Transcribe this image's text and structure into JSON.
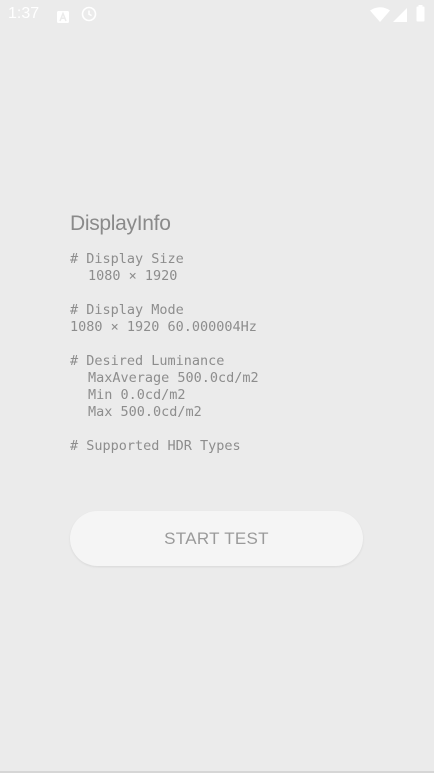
{
  "status_bar": {
    "time": "1:37",
    "icons": [
      "a-notification-icon",
      "clock-icon",
      "wifi-icon",
      "signal-icon",
      "battery-icon"
    ]
  },
  "display_info": {
    "title": "DisplayInfo",
    "display_size_header": "# Display Size",
    "display_size_value": "1080 × 1920",
    "display_mode_header": "# Display Mode",
    "display_mode_value": "1080 × 1920 60.000004Hz",
    "luminance_header": "# Desired Luminance",
    "max_average": "MaxAverage 500.0cd/m2",
    "min": "Min 0.0cd/m2",
    "max": "Max 500.0cd/m2",
    "hdr_header": "# Supported HDR Types"
  },
  "actions": {
    "start_test_label": "START TEST"
  },
  "colors": {
    "background": "#ebebeb",
    "text": "#8d8d8d",
    "button_bg": "#f5f5f5"
  }
}
